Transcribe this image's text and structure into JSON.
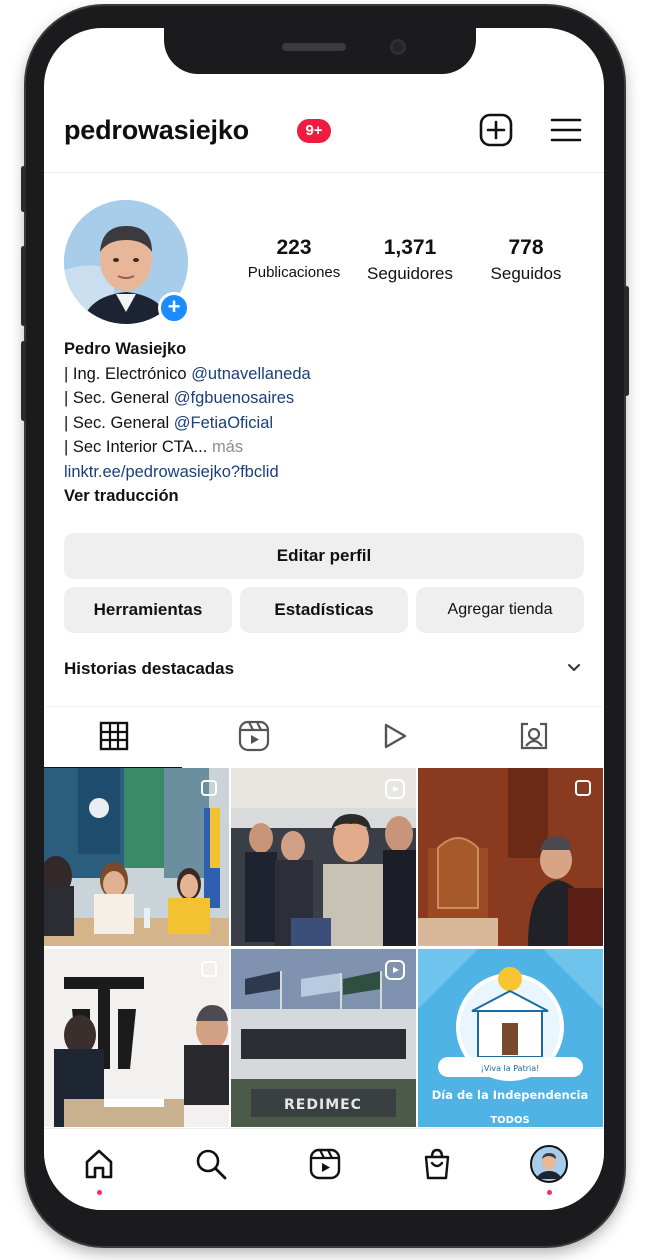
{
  "header": {
    "username": "pedrowasiejko",
    "notification_badge": "9+",
    "create_icon": "plus-square-icon",
    "menu_icon": "hamburger-icon"
  },
  "profile": {
    "stats": [
      {
        "value": "223",
        "label": "Publicaciones"
      },
      {
        "value": "1,371",
        "label": "Seguidores"
      },
      {
        "value": "778",
        "label": "Seguidos"
      }
    ],
    "name": "Pedro Wasiejko",
    "bio": [
      {
        "text": "| Ing. Electrónico ",
        "mention": "@utnavellaneda"
      },
      {
        "text": "| Sec. General ",
        "mention": "@fgbuenosaires"
      },
      {
        "text": "| Sec. General ",
        "mention": "@FetiaOficial"
      },
      {
        "text": "| Sec Interior CTA... ",
        "more": "más"
      }
    ],
    "link": "linktr.ee/pedrowasiejko?fbclid",
    "translate": "Ver traducción"
  },
  "actions": {
    "edit_profile": "Editar perfil",
    "tools": "Herramientas",
    "stats": "Estadísticas",
    "add_shop": "Agregar tienda"
  },
  "highlights": {
    "label": "Historias destacadas"
  },
  "tabs": [
    "grid-icon",
    "reels-icon",
    "video-play-icon",
    "tagged-icon"
  ],
  "posts": {
    "redimec_sign": "REDIMEC",
    "independence_small": "¡Viva la Patria!",
    "independence_title": "Día de la Independencia",
    "independence_footer": "TODOS"
  },
  "bottom_nav": [
    "home-icon",
    "search-icon",
    "reels-icon",
    "shop-icon",
    "profile-avatar"
  ],
  "colors": {
    "accent_blue": "#1a8cff",
    "badge_red": "#ee1d3f",
    "mention_blue": "#1b3f7a"
  }
}
